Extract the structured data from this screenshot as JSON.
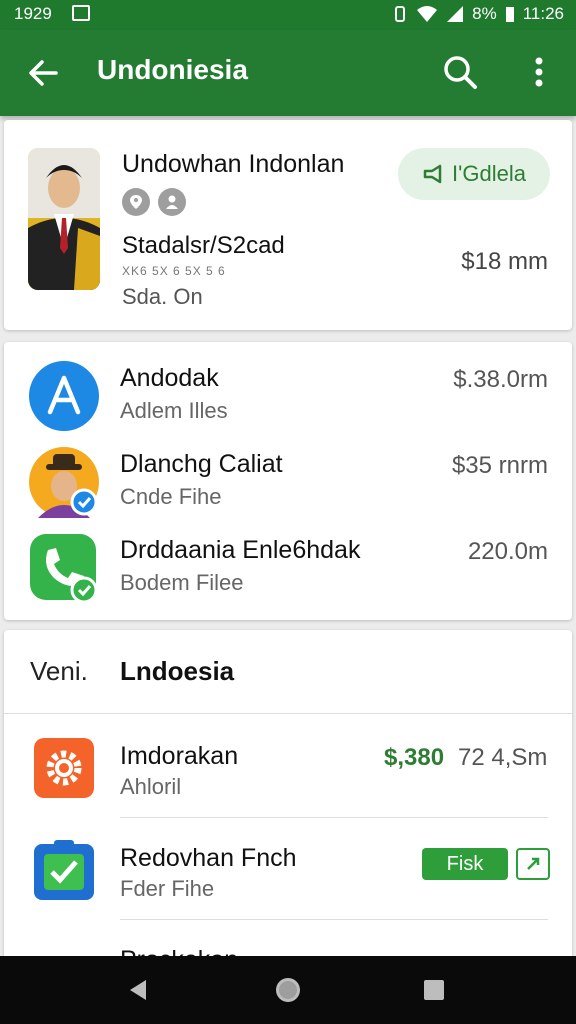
{
  "status_bar": {
    "time_left": "1929",
    "battery": "8%",
    "time_right": "11:26"
  },
  "app_bar": {
    "title": "Undoniesia",
    "icons": [
      "back-arrow-icon",
      "search-icon",
      "more-vert-icon"
    ]
  },
  "profile": {
    "name": "Undowhan Indonlan",
    "follow_label": "I'Gdlela",
    "subtitle": "Stadalsr/S2cad",
    "meta": "XK6 5X 6 5X 5 6",
    "note": "Sda. On",
    "price": "$18 mm"
  },
  "apps": [
    {
      "title": "Andodak",
      "subtitle": "Adlem Illes",
      "price": "$.38.0rm",
      "icon": "a-logo-icon"
    },
    {
      "title": "Dlanchg Caliat",
      "subtitle": "Cnde Fihe",
      "price": "$35 rnrm",
      "icon": "cowboy-avatar-icon"
    },
    {
      "title": "Drddaania Enle6hdak",
      "subtitle": "Bodem Filee",
      "price": "220.0m",
      "icon": "phone-icon"
    }
  ],
  "list": {
    "left_label": "Veni.",
    "title": "Lndoesia",
    "items": [
      {
        "title": "Imdorakan",
        "subtitle": "Ahloril",
        "price_green": "$,380",
        "price_gray": "72 4,Sm",
        "icon": "gear-icon"
      },
      {
        "title": "Redovhan Fnch",
        "subtitle": "Fder Fihe",
        "tag": "Fisk",
        "icon": "checklist-icon"
      },
      {
        "title": "Prockekan",
        "subtitle": "",
        "icon": "green-app-icon"
      }
    ]
  },
  "colors": {
    "brand": "#237c31",
    "accent_green": "#2e7d32",
    "follow_bg": "#e3f2e4"
  }
}
